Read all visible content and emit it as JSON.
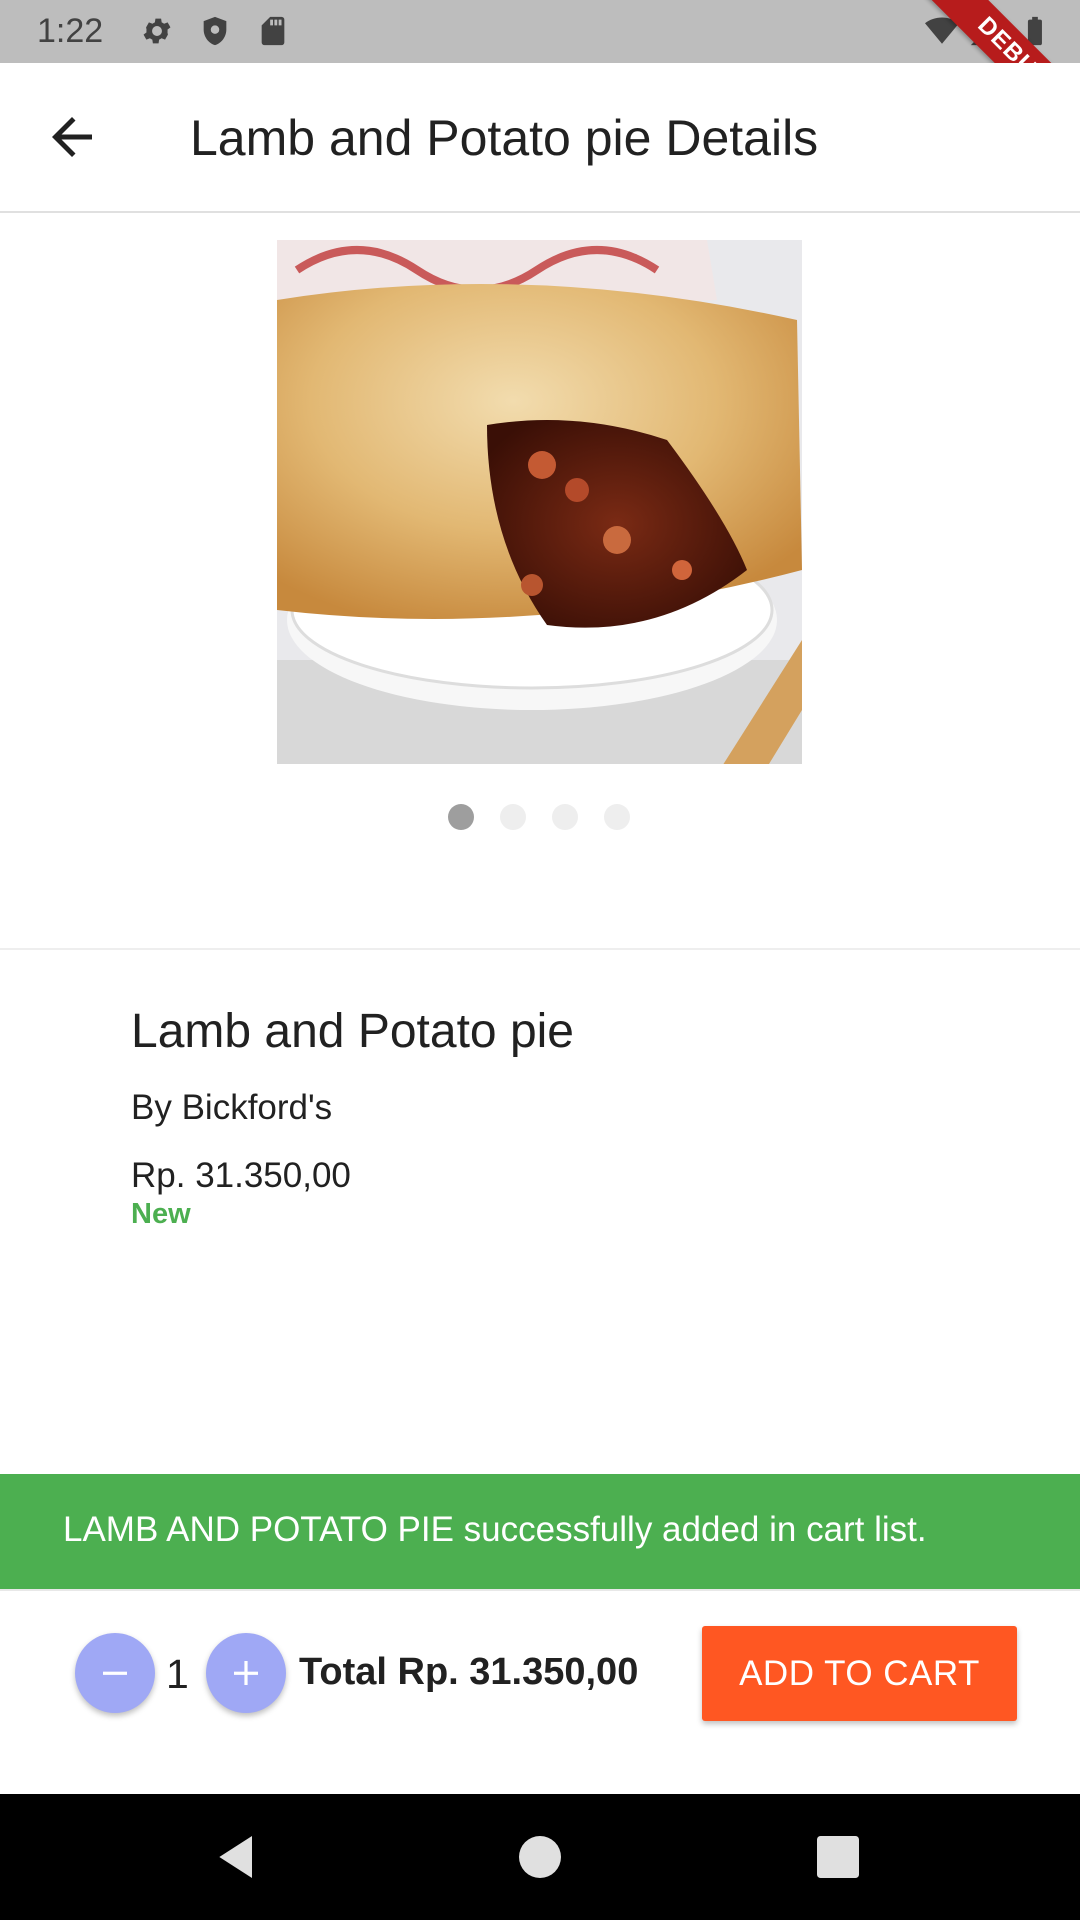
{
  "status_bar": {
    "time": "1:22",
    "icons": [
      "gear-icon",
      "shield-icon",
      "sd-card-icon",
      "wifi-icon",
      "signal-icon",
      "battery-icon"
    ],
    "debug_label": "DEBUG"
  },
  "app_bar": {
    "title": "Lamb and Potato pie Details",
    "back_icon": "arrow-back-icon"
  },
  "carousel": {
    "image": "lamb-potato-pie-photo",
    "pages": 4,
    "active_page": 1
  },
  "product": {
    "name": "Lamb and Potato pie",
    "brand": "By Bickford's",
    "price": "Rp. 31.350,00",
    "status": "New"
  },
  "snackbar": {
    "message": "LAMB AND POTATO PIE successfully added in cart list."
  },
  "cart_bar": {
    "quantity": "1",
    "total": "Total Rp. 31.350,00",
    "add_button": "ADD TO CART"
  },
  "colors": {
    "accent": "#ff5722",
    "success": "#4caf50",
    "qty_button": "#9fa8f5",
    "status_bar": "#bdbdbd"
  }
}
